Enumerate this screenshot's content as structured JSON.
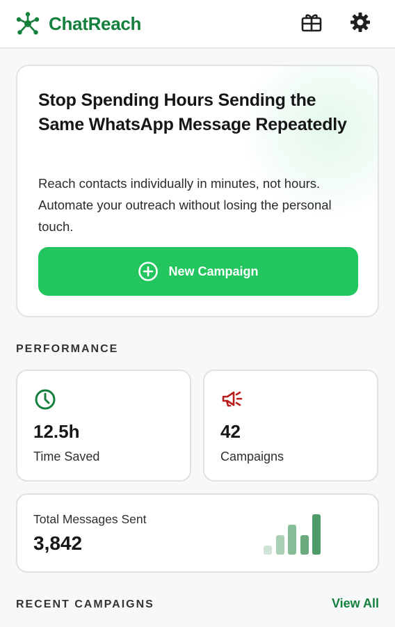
{
  "header": {
    "brand_name": "ChatReach",
    "icons": [
      "network-logo-icon",
      "gift-icon",
      "gear-icon"
    ]
  },
  "hero": {
    "title": "Stop Spending Hours Sending the Same WhatsApp Message Repeatedly",
    "description": "Reach contacts individually in minutes, not hours. Automate your outreach without losing the personal touch.",
    "cta_label": "New Campaign"
  },
  "performance": {
    "section_label": "PERFORMANCE",
    "time_saved": {
      "value": "12.5h",
      "caption": "Time Saved",
      "icon": "clock-icon"
    },
    "campaigns": {
      "value": "42",
      "caption": "Campaigns",
      "icon": "megaphone-icon"
    },
    "total_messages": {
      "caption": "Total Messages Sent",
      "value": "3,842",
      "trend_bars": [
        0.22,
        0.47,
        0.72,
        0.47,
        0.97
      ]
    }
  },
  "recent": {
    "section_label": "RECENT CAMPAIGNS",
    "view_all_label": "View All"
  },
  "colors": {
    "brand": "#15803d",
    "accent": "#22c55e",
    "megaphone": "#b91c1c",
    "bar_shades": [
      "#cfe3d6",
      "#a9d0b5",
      "#86bd97",
      "#6aaa7e",
      "#4f9a69"
    ]
  }
}
